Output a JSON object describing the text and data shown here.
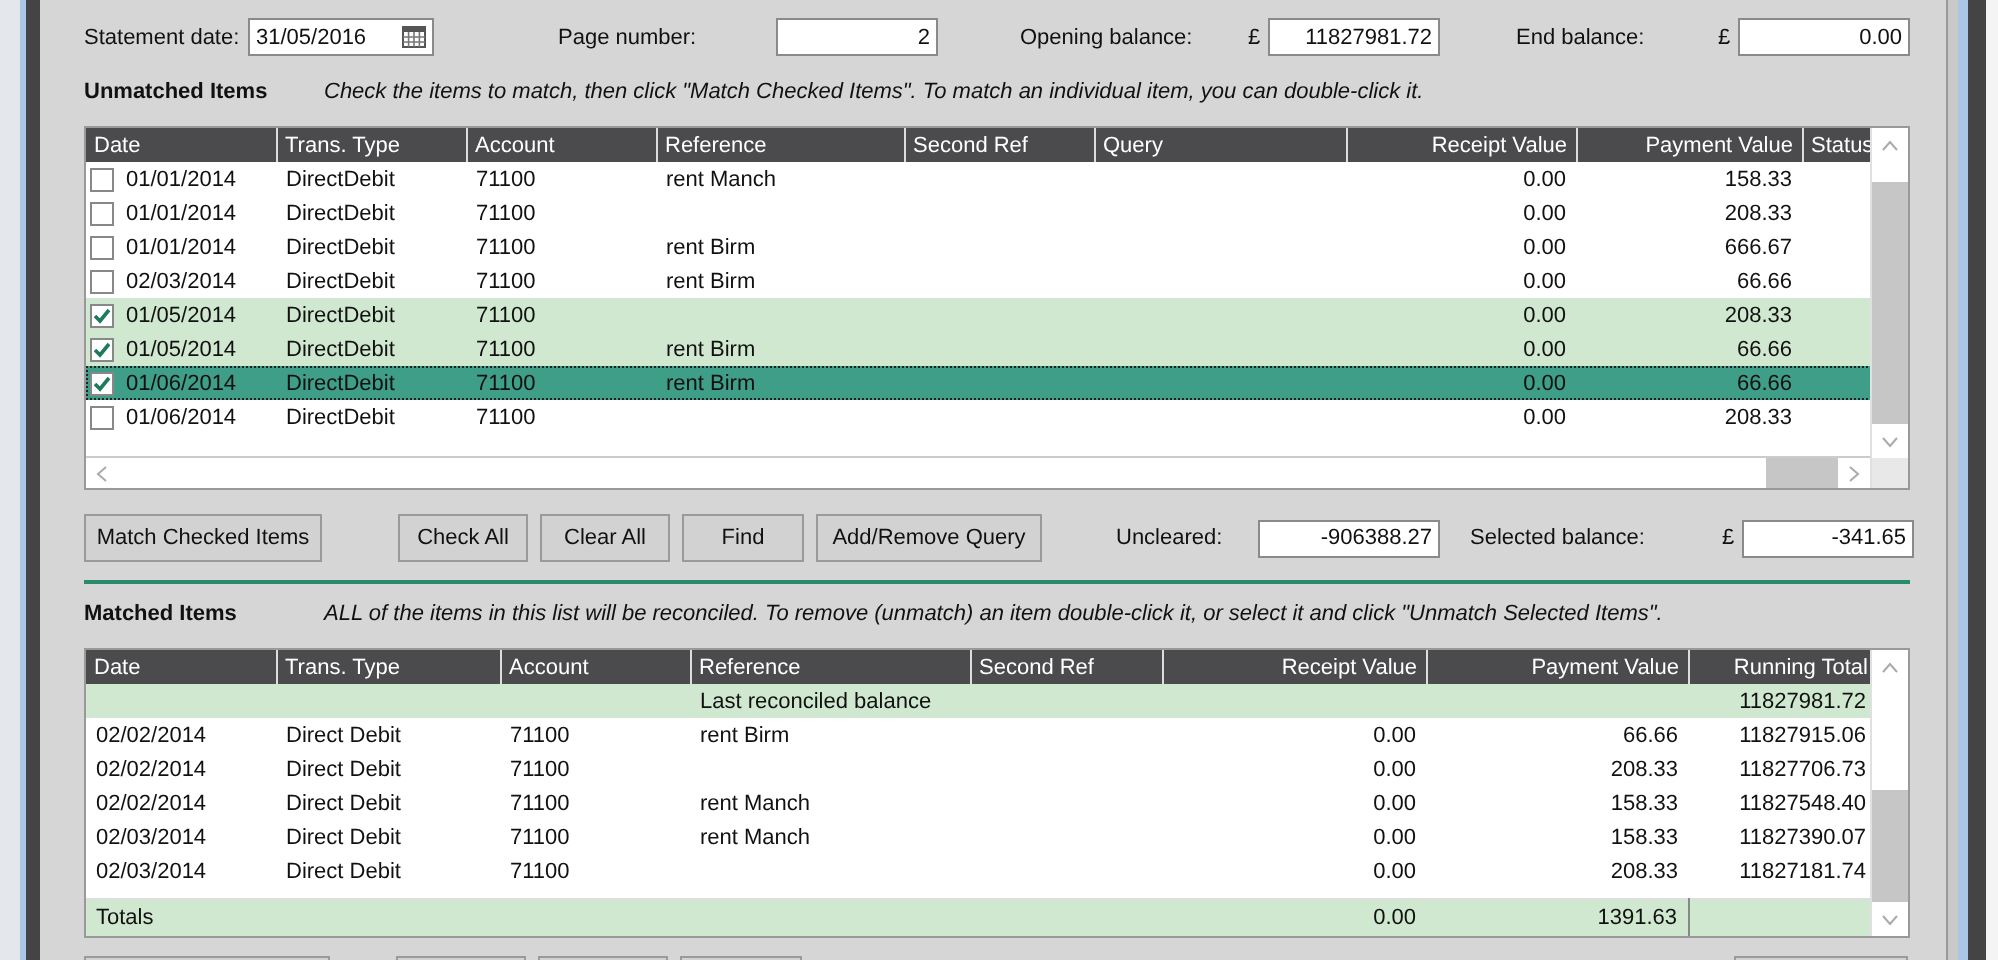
{
  "fields": {
    "statement_date": {
      "label": "Statement date:",
      "value": "31/05/2016"
    },
    "page_number": {
      "label": "Page number:",
      "value": "2"
    },
    "opening_balance": {
      "label": "Opening balance:",
      "currency": "£",
      "value": "11827981.72"
    },
    "end_balance": {
      "label": "End balance:",
      "currency": "£",
      "value": "0.00"
    }
  },
  "unmatched": {
    "title": "Unmatched Items",
    "hint": "Check the items to match, then click \"Match Checked Items\". To match an individual item, you can double-click it.",
    "columns": [
      "Date",
      "Trans. Type",
      "Account",
      "Reference",
      "Second Ref",
      "Query",
      "Receipt Value",
      "Payment Value",
      "Status"
    ],
    "rows": [
      {
        "checked": false,
        "selected": false,
        "date": "01/01/2014",
        "type": "DirectDebit",
        "account": "71100",
        "reference": "rent Manch",
        "receipt": "0.00",
        "payment": "158.33"
      },
      {
        "checked": false,
        "selected": false,
        "date": "01/01/2014",
        "type": "DirectDebit",
        "account": "71100",
        "receipt": "0.00",
        "payment": "208.33"
      },
      {
        "checked": false,
        "selected": false,
        "date": "01/01/2014",
        "type": "DirectDebit",
        "account": "71100",
        "reference": "rent Birm",
        "receipt": "0.00",
        "payment": "666.67"
      },
      {
        "checked": false,
        "selected": false,
        "date": "02/03/2014",
        "type": "DirectDebit",
        "account": "71100",
        "reference": "rent Birm",
        "receipt": "0.00",
        "payment": "66.66"
      },
      {
        "checked": true,
        "selected": false,
        "date": "01/05/2014",
        "type": "DirectDebit",
        "account": "71100",
        "receipt": "0.00",
        "payment": "208.33"
      },
      {
        "checked": true,
        "selected": false,
        "date": "01/05/2014",
        "type": "DirectDebit",
        "account": "71100",
        "reference": "rent Birm",
        "receipt": "0.00",
        "payment": "66.66"
      },
      {
        "checked": true,
        "selected": true,
        "date": "01/06/2014",
        "type": "DirectDebit",
        "account": "71100",
        "reference": "rent Birm",
        "receipt": "0.00",
        "payment": "66.66"
      },
      {
        "checked": false,
        "selected": false,
        "date": "01/06/2014",
        "type": "DirectDebit",
        "account": "71100",
        "receipt": "0.00",
        "payment": "208.33"
      }
    ]
  },
  "buttons": [
    "Match Checked Items",
    "Check All",
    "Clear All",
    "Find",
    "Add/Remove Query"
  ],
  "uncleared": {
    "label": "Uncleared:",
    "value": "-906388.27"
  },
  "selected_balance": {
    "label": "Selected balance:",
    "currency": "£",
    "value": "-341.65"
  },
  "matched": {
    "title": "Matched Items",
    "hint": "ALL of the items in this list will be reconciled. To remove (unmatch) an item double-click it, or select it and click \"Unmatch Selected Items\".",
    "columns": [
      "Date",
      "Trans. Type",
      "Account",
      "Reference",
      "Second Ref",
      "Receipt Value",
      "Payment Value",
      "Running Total"
    ],
    "rows": [
      {
        "kind": "balance",
        "reference": "Last reconciled balance",
        "running": "11827981.72"
      },
      {
        "kind": "item",
        "date": "02/02/2014",
        "type": "Direct Debit",
        "account": "71100",
        "reference": "rent Birm",
        "receipt": "0.00",
        "payment": "66.66",
        "running": "11827915.06"
      },
      {
        "kind": "item",
        "date": "02/02/2014",
        "type": "Direct Debit",
        "account": "71100",
        "receipt": "0.00",
        "payment": "208.33",
        "running": "11827706.73"
      },
      {
        "kind": "item",
        "date": "02/02/2014",
        "type": "Direct Debit",
        "account": "71100",
        "reference": "rent Manch",
        "receipt": "0.00",
        "payment": "158.33",
        "running": "11827548.40"
      },
      {
        "kind": "item",
        "date": "02/03/2014",
        "type": "Direct Debit",
        "account": "71100",
        "reference": "rent Manch",
        "receipt": "0.00",
        "payment": "158.33",
        "running": "11827390.07"
      },
      {
        "kind": "item",
        "date": "02/03/2014",
        "type": "Direct Debit",
        "account": "71100",
        "receipt": "0.00",
        "payment": "208.33",
        "running": "11827181.74"
      }
    ],
    "totals": {
      "label": "Totals",
      "receipt": "0.00",
      "payment": "1391.63"
    }
  }
}
